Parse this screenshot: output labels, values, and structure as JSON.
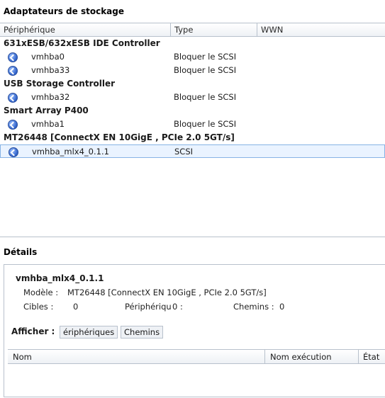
{
  "adapters_section": {
    "title": "Adaptateurs de stockage",
    "columns": [
      "Périphérique",
      "Type",
      "WWN"
    ],
    "groups": [
      {
        "name": "631xESB/632xESB IDE Controller",
        "items": [
          {
            "device": "vmhba0",
            "type": "Bloquer le SCSI"
          },
          {
            "device": "vmhba33",
            "type": "Bloquer le SCSI"
          }
        ]
      },
      {
        "name": "USB Storage Controller",
        "items": [
          {
            "device": "vmhba32",
            "type": "Bloquer le SCSI"
          }
        ]
      },
      {
        "name": "Smart Array P400",
        "items": [
          {
            "device": "vmhba1",
            "type": "Bloquer le SCSI"
          }
        ]
      },
      {
        "name": "MT26448 [ConnectX EN 10GigE , PCIe 2.0 5GT/s]",
        "items": [
          {
            "device": "vmhba_mlx4_0.1.1",
            "type": "SCSI",
            "selected": true
          }
        ]
      }
    ]
  },
  "details_section": {
    "title": "Détails",
    "device_name": "vmhba_mlx4_0.1.1",
    "model_label": "Modèle :",
    "model_value": "MT26448 [ConnectX EN 10GigE , PCIe 2.0 5GT/s]",
    "targets_label": "Cibles :",
    "targets_value": "0",
    "devices_label": "Périphériqu",
    "devices_value": "0 :",
    "paths_label": "Chemins :",
    "paths_value": "0",
    "show_label": "Afficher :",
    "tab_devices": "ériphériques",
    "tab_paths": "Chemins",
    "columns": [
      "Nom",
      "Nom exécution",
      "État"
    ]
  }
}
